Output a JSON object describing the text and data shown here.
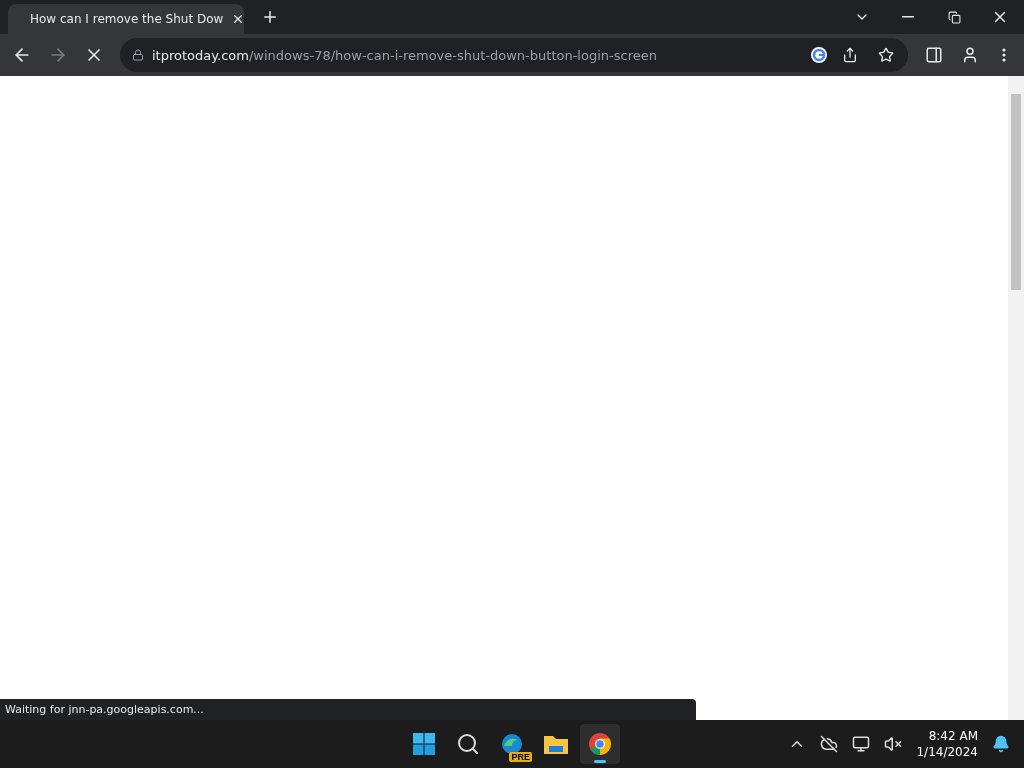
{
  "tabs": [
    {
      "title": "How can I remove the Shut Dow",
      "selected": true
    }
  ],
  "address_bar": {
    "host": "itprotoday.com",
    "path": "/windows-78/how-can-i-remove-shut-down-button-login-screen"
  },
  "loading": true,
  "status_bubble": "Waiting for jnn-pa.googleapis.com...",
  "taskbar": {
    "apps": [
      {
        "kind": "start",
        "selected": false
      },
      {
        "kind": "search",
        "selected": false
      },
      {
        "kind": "edge",
        "badge": "PRE",
        "selected": false
      },
      {
        "kind": "files",
        "selected": false
      },
      {
        "kind": "chrome",
        "selected": true
      }
    ],
    "time": "8:42 AM",
    "date": "1/14/2024"
  }
}
